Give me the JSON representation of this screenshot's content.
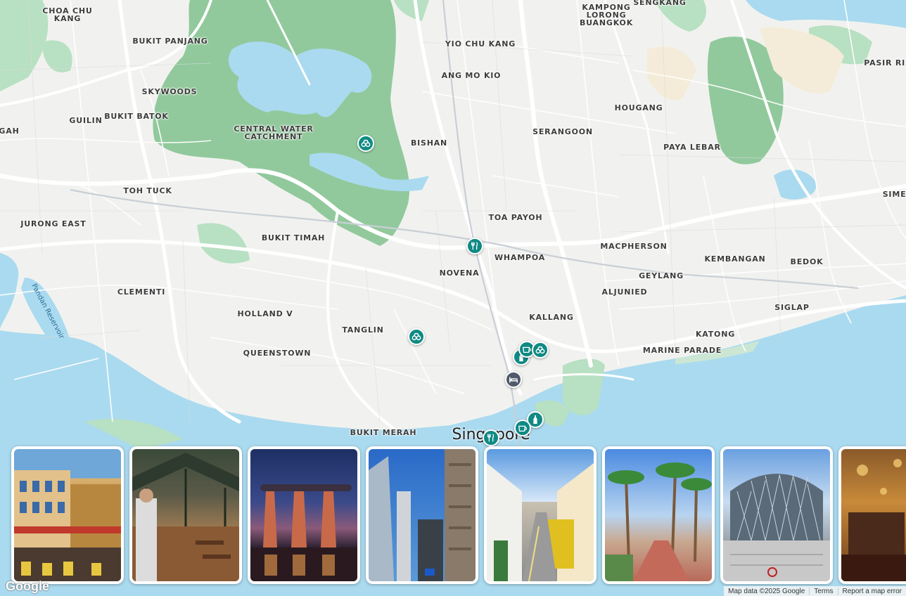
{
  "map": {
    "city": "Singapore",
    "water_label": "Pandan Reservoir",
    "areas": [
      {
        "id": "choa-chu-kang",
        "text": "CHOA CHU\nKANG"
      },
      {
        "id": "bukit-panjang",
        "text": "BUKIT PANJANG"
      },
      {
        "id": "skywoods",
        "text": "SKYWOODS"
      },
      {
        "id": "guilin",
        "text": "GUILIN"
      },
      {
        "id": "bukit-batok",
        "text": "BUKIT BATOK"
      },
      {
        "id": "gah",
        "text": "GAH"
      },
      {
        "id": "central-water-catchment",
        "text": "CENTRAL WATER\nCATCHMENT"
      },
      {
        "id": "toh-tuck",
        "text": "TOH TUCK"
      },
      {
        "id": "jurong-east",
        "text": "JURONG EAST"
      },
      {
        "id": "bukit-timah",
        "text": "BUKIT TIMAH"
      },
      {
        "id": "clementi",
        "text": "CLEMENTI"
      },
      {
        "id": "holland-v",
        "text": "HOLLAND V"
      },
      {
        "id": "queenstown",
        "text": "QUEENSTOWN"
      },
      {
        "id": "tanglin",
        "text": "TANGLIN"
      },
      {
        "id": "bukit-merah",
        "text": "BUKIT MERAH"
      },
      {
        "id": "yio-chu-kang",
        "text": "YIO CHU KANG"
      },
      {
        "id": "ang-mo-kio",
        "text": "ANG MO KIO"
      },
      {
        "id": "bishan",
        "text": "BISHAN"
      },
      {
        "id": "serangoon",
        "text": "SERANGOON"
      },
      {
        "id": "toa-payoh",
        "text": "TOA PAYOH"
      },
      {
        "id": "whampoa",
        "text": "WHAMPOA"
      },
      {
        "id": "novena",
        "text": "NOVENA"
      },
      {
        "id": "kallang",
        "text": "KALLANG"
      },
      {
        "id": "kampong-lorong-buangkok",
        "text": "KAMPONG\nLORONG\nBUANGKOK"
      },
      {
        "id": "sengkang",
        "text": "SENGKANG"
      },
      {
        "id": "hougang",
        "text": "HOUGANG"
      },
      {
        "id": "paya-lebar",
        "text": "PAYA LEBAR"
      },
      {
        "id": "pasir-ris",
        "text": "PASIR RIS"
      },
      {
        "id": "simei",
        "text": "SIMEI"
      },
      {
        "id": "macpherson",
        "text": "MACPHERSON"
      },
      {
        "id": "kembangan",
        "text": "KEMBANGAN"
      },
      {
        "id": "bedok",
        "text": "BEDOK"
      },
      {
        "id": "geylang",
        "text": "GEYLANG"
      },
      {
        "id": "aljunied",
        "text": "ALJUNIED"
      },
      {
        "id": "siglap",
        "text": "SIGLAP"
      },
      {
        "id": "katong",
        "text": "KATONG"
      },
      {
        "id": "marine-parade",
        "text": "MARINE PARADE"
      }
    ],
    "pins": [
      {
        "id": "pin-1",
        "icon": "binoculars-icon",
        "color": "#0f8a84"
      },
      {
        "id": "pin-2",
        "icon": "utensils-icon",
        "color": "#0f8a84"
      },
      {
        "id": "pin-3",
        "icon": "binoculars-icon",
        "color": "#0f8a84"
      },
      {
        "id": "pin-4",
        "icon": "coffee-icon",
        "color": "#0f8a84"
      },
      {
        "id": "pin-5",
        "icon": "binoculars-icon",
        "color": "#0f8a84"
      },
      {
        "id": "pin-6",
        "icon": "bed-icon",
        "color": "#4f5a6b"
      },
      {
        "id": "pin-7",
        "icon": "bottle-icon",
        "color": "#0f8a84"
      },
      {
        "id": "pin-8",
        "icon": "coffee-icon",
        "color": "#0f8a84"
      },
      {
        "id": "pin-9",
        "icon": "utensils-icon",
        "color": "#0f8a84"
      }
    ]
  },
  "photos": [
    {
      "id": "photo-1",
      "subject": "chinatown-shophouses"
    },
    {
      "id": "photo-2",
      "subject": "hawker-centre-interior"
    },
    {
      "id": "photo-3",
      "subject": "marina-bay-sands-night"
    },
    {
      "id": "photo-4",
      "subject": "cbd-skyscrapers"
    },
    {
      "id": "photo-5",
      "subject": "haji-lane-street"
    },
    {
      "id": "photo-6",
      "subject": "palm-lined-street"
    },
    {
      "id": "photo-7",
      "subject": "orchard-road-mall"
    },
    {
      "id": "photo-8",
      "subject": "ornate-interior"
    }
  ],
  "footer": {
    "logo": "Google",
    "map_data": "Map data ©2025 Google",
    "terms": "Terms",
    "report": "Report a map error"
  }
}
